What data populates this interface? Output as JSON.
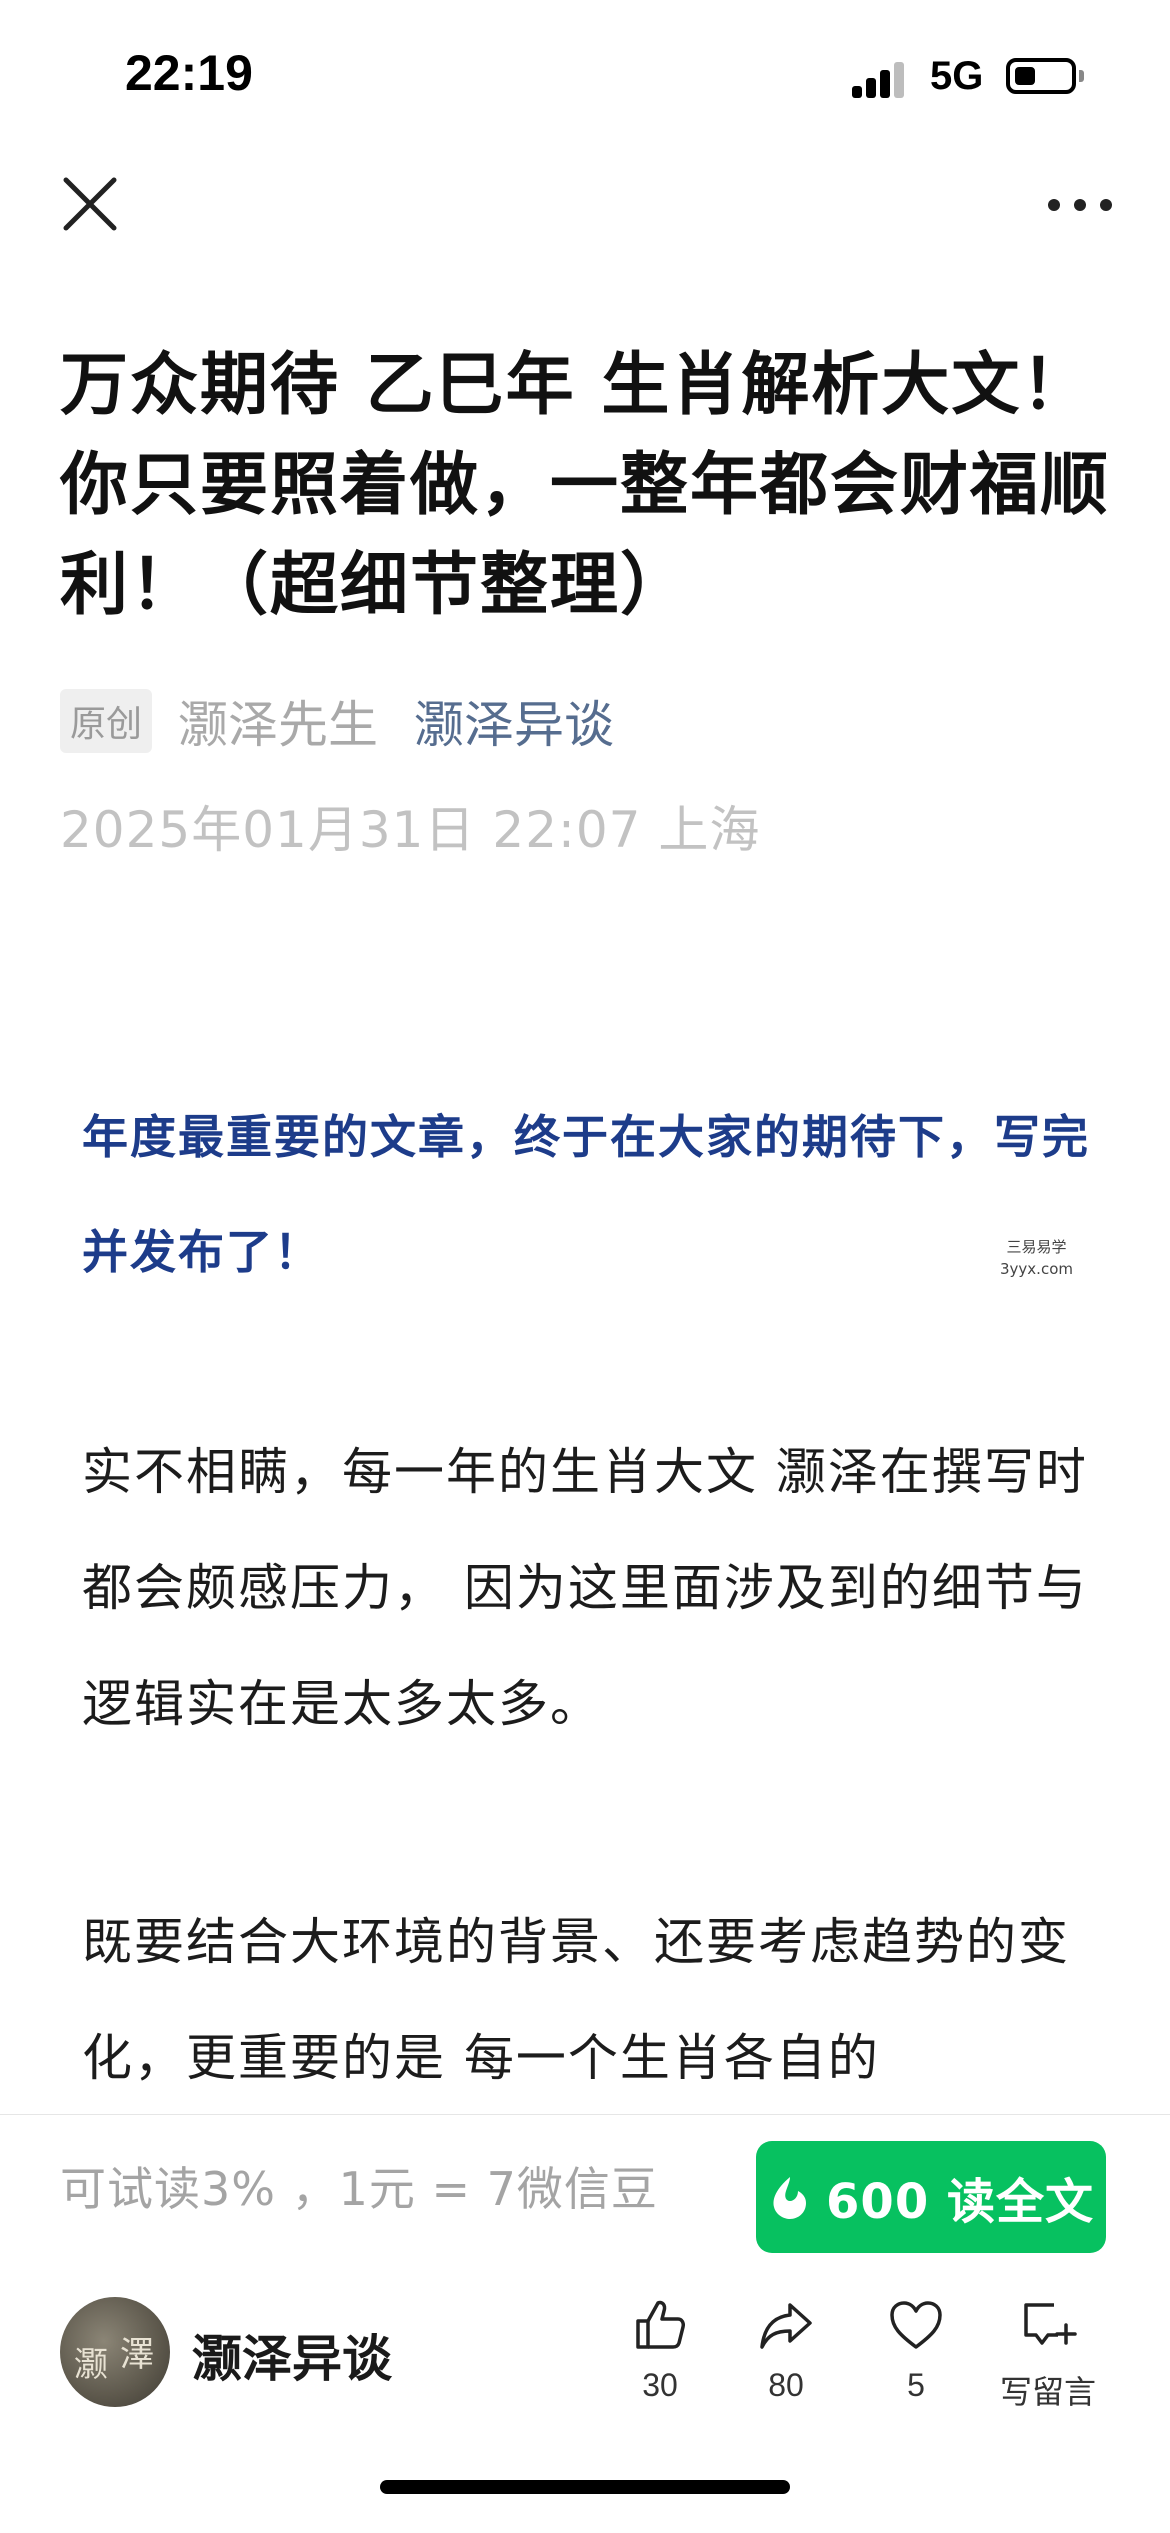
{
  "status_bar": {
    "time": "22:19",
    "network": "5G"
  },
  "nav": {
    "close_icon": "close-icon",
    "more_icon": "more-icon"
  },
  "article": {
    "title": "万众期待 乙巳年 生肖解析大文！ 你只要照着做，一整年都会财福顺利！（超细节整理）",
    "original_badge": "原创",
    "author": "灏泽先生",
    "account": "灏泽异谈",
    "publish_info": "2025年01月31日 22:07 上海",
    "highlight": "年度最重要的文章，终于在大家的期待下，写完并发布了！",
    "watermark_line1": "三易易学",
    "watermark_line2": "3yyx.com",
    "paragraph1": "实不相瞒，每一年的生肖大文 灏泽在撰写时都会颇感压力， 因为这里面涉及到的细节与逻辑实在是太多太多。",
    "paragraph2": "既要结合大环境的背景、还要考虑趋势的变化，更重要的是 每一个生肖各自的"
  },
  "paywall": {
    "trial_text": "可试读3% ，1元 = 7微信豆",
    "buy_label": "600 读全文",
    "accent_color": "#07c160"
  },
  "footer": {
    "account_name": "灏泽异谈",
    "avatar_glyphs": [
      "灏",
      "澤"
    ],
    "like_count": "30",
    "share_count": "80",
    "favorite_count": "5",
    "comment_label": "写留言"
  }
}
